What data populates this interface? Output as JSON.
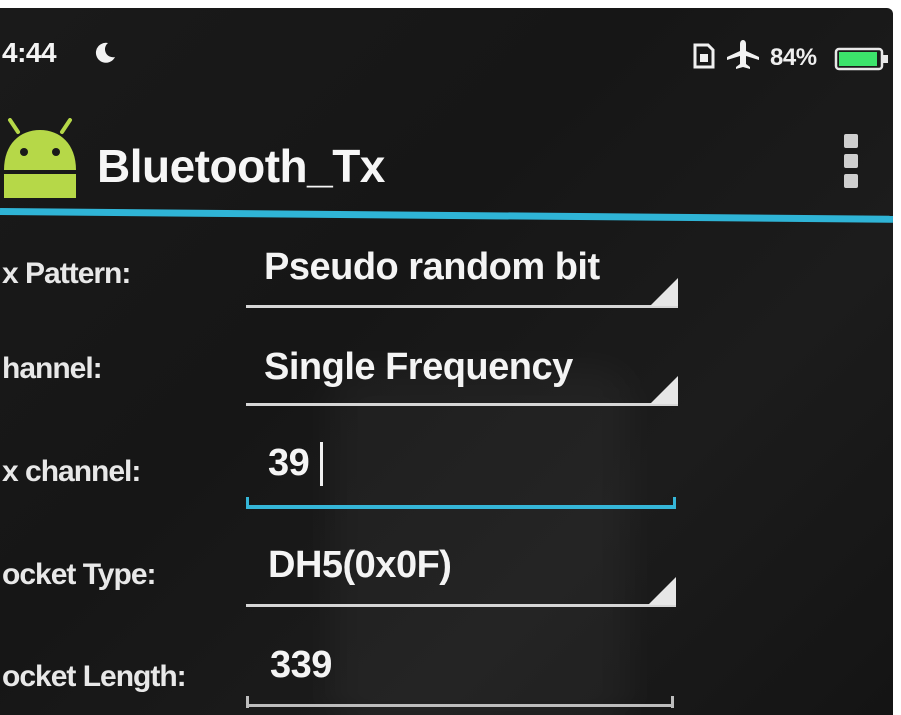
{
  "status_bar": {
    "time": "4:44",
    "battery_percent": "84%",
    "icons": [
      "moon-icon",
      "sim-icon",
      "airplane-icon",
      "battery-icon"
    ]
  },
  "action_bar": {
    "title": "Bluetooth_Tx",
    "app_icon": "android-icon",
    "menu_icon": "overflow-menu-icon"
  },
  "colors": {
    "accent": "#2fb4d6",
    "background": "#1a1a1a",
    "text": "#f4f4f4",
    "battery": "#3ce36b"
  },
  "form": {
    "tx_pattern": {
      "label": "x Pattern:",
      "value": "Pseudo random bit"
    },
    "channel": {
      "label": "hannel:",
      "value": "Single Frequency"
    },
    "tx_channel": {
      "label": "x channel:",
      "value": "39"
    },
    "pocket_type": {
      "label": "ocket Type:",
      "value": "DH5(0x0F)"
    },
    "pocket_length": {
      "label": "ocket Length:",
      "value": "339"
    }
  }
}
